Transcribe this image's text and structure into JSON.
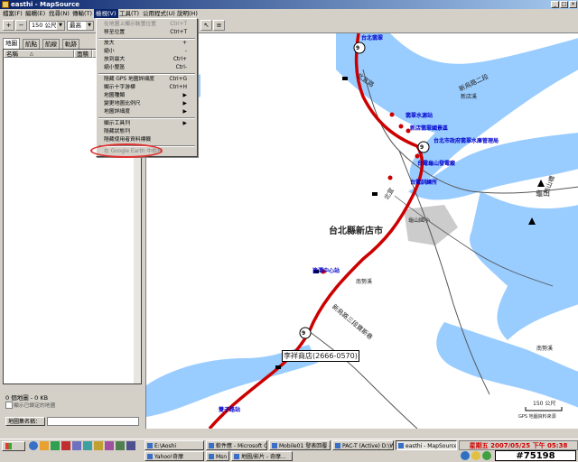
{
  "window": {
    "title": "easthi - MapSource"
  },
  "menubar": {
    "items": [
      "檔案(F)",
      "編輯(E)",
      "找尋(N)",
      "傳輸(T)",
      "檢視(V)",
      "工具(T)",
      "公用程式(U)",
      "說明(H)"
    ],
    "active_index": 4
  },
  "toolbar": {
    "zoom_value": "150 公尺",
    "detail_value": "最高"
  },
  "view_menu": {
    "items": [
      {
        "label": "在地圖上顯示裝置位置",
        "shortcut": "Ctrl+T",
        "disabled": true
      },
      {
        "label": "移至位置",
        "shortcut": "Ctrl+T",
        "disabled": false
      },
      {
        "label": "放大",
        "shortcut": "+",
        "disabled": false
      },
      {
        "label": "縮小",
        "shortcut": "-",
        "disabled": false
      },
      {
        "label": "放到最大",
        "shortcut": "Ctrl+",
        "disabled": false
      },
      {
        "label": "縮小整區",
        "shortcut": "Ctrl-",
        "disabled": false
      },
      {
        "label": "隱藏 GPS 地圖詳細度",
        "shortcut": "Ctrl+G",
        "disabled": false
      },
      {
        "label": "顯示十字游標",
        "shortcut": "Ctrl+H",
        "disabled": false
      },
      {
        "label": "地圖種類",
        "shortcut": "▶",
        "disabled": false
      },
      {
        "label": "變更地圖比例尺",
        "shortcut": "▶",
        "disabled": false
      },
      {
        "label": "地圖詳細度",
        "shortcut": "▶",
        "disabled": false
      },
      {
        "label": "顯示工具列",
        "shortcut": "▶",
        "disabled": false
      },
      {
        "label": "隱藏狀態列",
        "shortcut": "",
        "disabled": false
      },
      {
        "label": "隱藏使用者資料標籤",
        "shortcut": "",
        "disabled": false
      },
      {
        "label": "在 Google Earth 中檢視",
        "shortcut": "",
        "disabled": true
      }
    ]
  },
  "left_panel": {
    "tabs": [
      "地圖",
      "航點",
      "航線",
      "軌跡"
    ],
    "selected_tab": 0,
    "columns": [
      "名稱",
      "面積"
    ],
    "footer_size": "0 個地圖 - 0 KB",
    "checkbox1_label": "顯示已鎖定的地圖",
    "checkbox2_label": "",
    "map_name_button": "地圖集名稱："
  },
  "map": {
    "labels": {
      "city": "台北縣新店市",
      "road_9": "9",
      "store": "李祥商店(2666-0570)",
      "mountain": "龜山",
      "mountain2": "枋山橋",
      "road_xinwu": "新烏路二段",
      "road_xinwu3": "新烏路三段寶斯巷",
      "p1": "翡翠水源站",
      "p2": "新店翡翠國景區",
      "p3": "台北市政府翡翠水庫管理局",
      "p4": "台電龜山發電廠",
      "p5": "台電訓練所",
      "p6": "龜山國小",
      "p7": "塗潭中心站",
      "p8": "南勢溪",
      "p9": "新店溪",
      "p10": "雙子路站",
      "p11": "南勢溪",
      "p12": "台北翡翠",
      "road_bend": "北宜路",
      "road_bend2": "北宜",
      "scale": "150 公尺",
      "credit": "GPS 地圖資料來源"
    }
  },
  "taskbar": {
    "tasks": [
      "E:\\Aoshi",
      "軟件應 - Microsoft O...",
      "Mobile01 發表回覆 - ...",
      "PAC-T (Active) D:\\W...",
      "easthi - MapSource",
      "Yahoo!奇摩",
      "Msn",
      "地圖/影片 - 奇摩..."
    ],
    "active_index": 4,
    "clock": "星期五 2007/05/25 下午 05:38",
    "watermark": "#75198"
  },
  "colors": {
    "title_start": "#0a246a",
    "water": "#99ccff",
    "road": "#cc0000",
    "menu_bg": "#d4d0c8",
    "highlight": "#e03030"
  }
}
